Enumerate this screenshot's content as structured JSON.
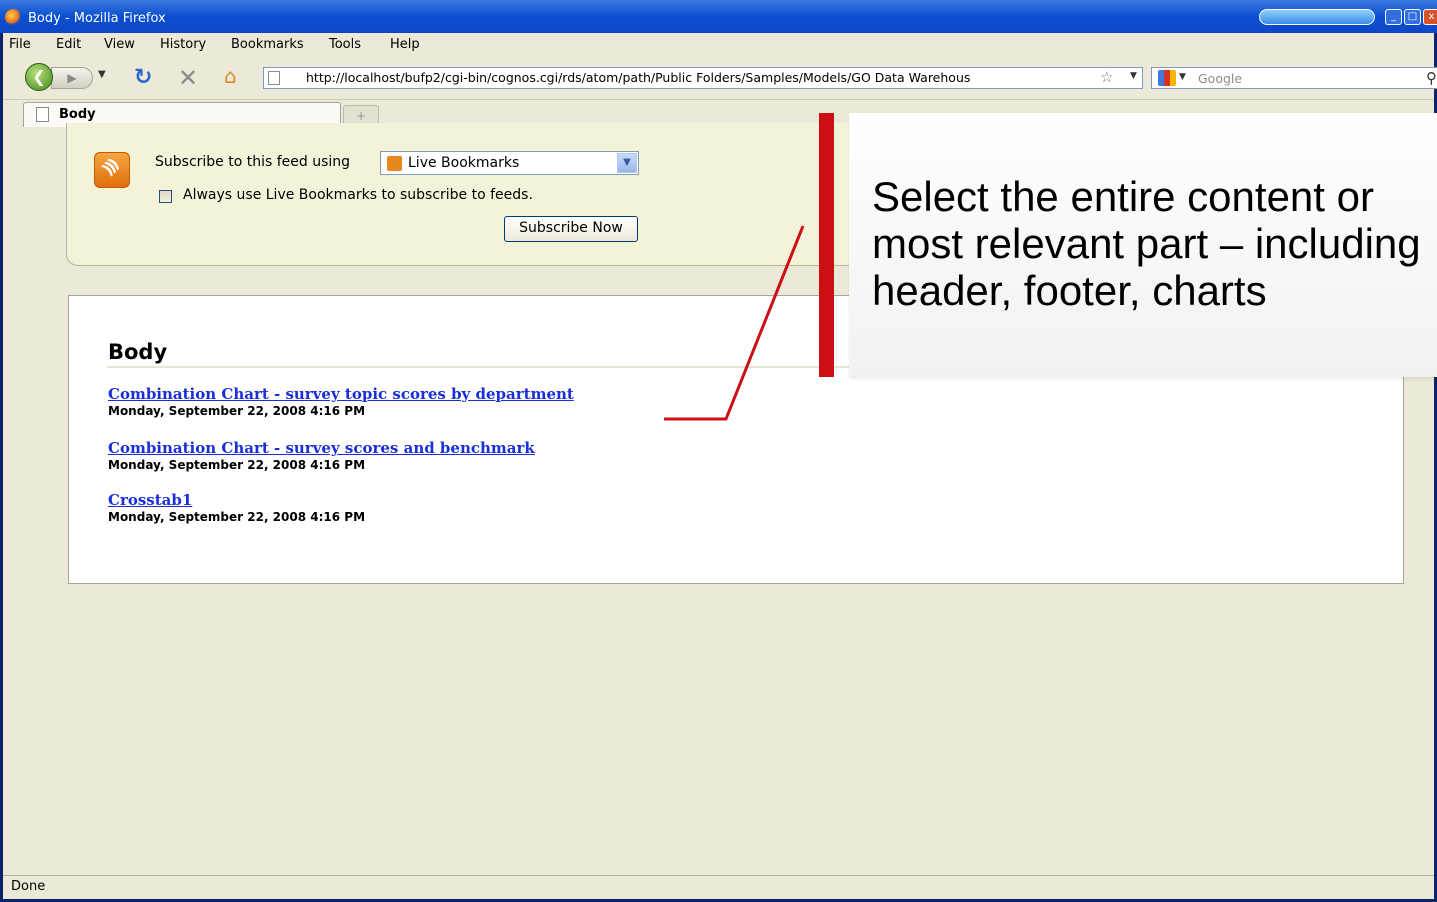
{
  "window": {
    "title": "Body - Mozilla Firefox"
  },
  "menu": [
    "File",
    "Edit",
    "View",
    "History",
    "Bookmarks",
    "Tools",
    "Help"
  ],
  "nav": {
    "url": "http://localhost/bufp2/cgi-bin/cognos.cgi/rds/atom/path/Public Folders/Samples/Models/GO Data Warehous",
    "search_placeholder": "Google"
  },
  "tab": {
    "label": "Body",
    "new_tab": "+"
  },
  "feed": {
    "subscribe_label": "Subscribe to this feed using",
    "reader_selected": "Live Bookmarks",
    "always_use_label": "Always use Live Bookmarks to subscribe to feeds.",
    "subscribe_button": "Subscribe Now"
  },
  "body": {
    "heading": "Body",
    "entries": [
      {
        "title": "Combination Chart - survey topic scores by department",
        "date": "Monday, September 22, 2008 4:16 PM"
      },
      {
        "title": "Combination Chart - survey scores and benchmark",
        "date": "Monday, September 22, 2008 4:16 PM"
      },
      {
        "title": "Crosstab1",
        "date": "Monday, September 22, 2008 4:16 PM"
      }
    ]
  },
  "callout": {
    "text": "Select the entire content or\nmost relevant part – including\nheader, footer, charts"
  },
  "status": "Done",
  "colors": {
    "accent_red": "#cc0f14",
    "link": "#1a2ed9",
    "titlebar": "#0a4fd0"
  }
}
